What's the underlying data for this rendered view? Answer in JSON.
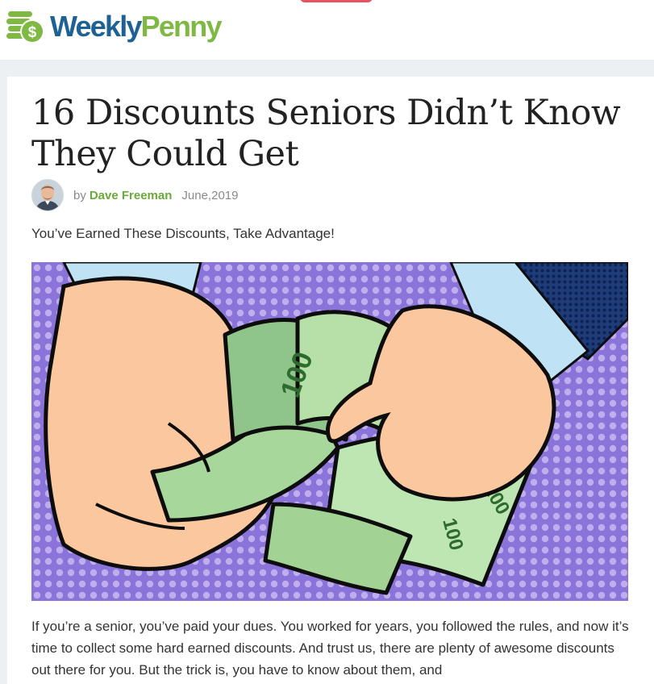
{
  "site": {
    "logo_word_1": "Weekly",
    "logo_word_2": "Penny",
    "colors": {
      "brand_blue": "#1e6293",
      "brand_green": "#7fb943",
      "accent_red": "#e8535f"
    }
  },
  "article": {
    "title": "16 Discounts Seniors Didn’t Know They Could Get",
    "byline_prefix": "by",
    "author": "Dave Freeman",
    "date": "June,2019",
    "subtitle": "You’ve Earned These Discounts, Take Advantage!",
    "hero_image": "hands-counting-100-dollar-bills-pop-art",
    "banknote_label": "100",
    "body_text": "If you’re a senior, you’ve paid your dues. You worked for years, you followed the rules, and now it’s time to collect some hard earned discounts. And trust us, there are plenty of awesome discounts out there for you. But the trick is, you have to know about them, and"
  }
}
